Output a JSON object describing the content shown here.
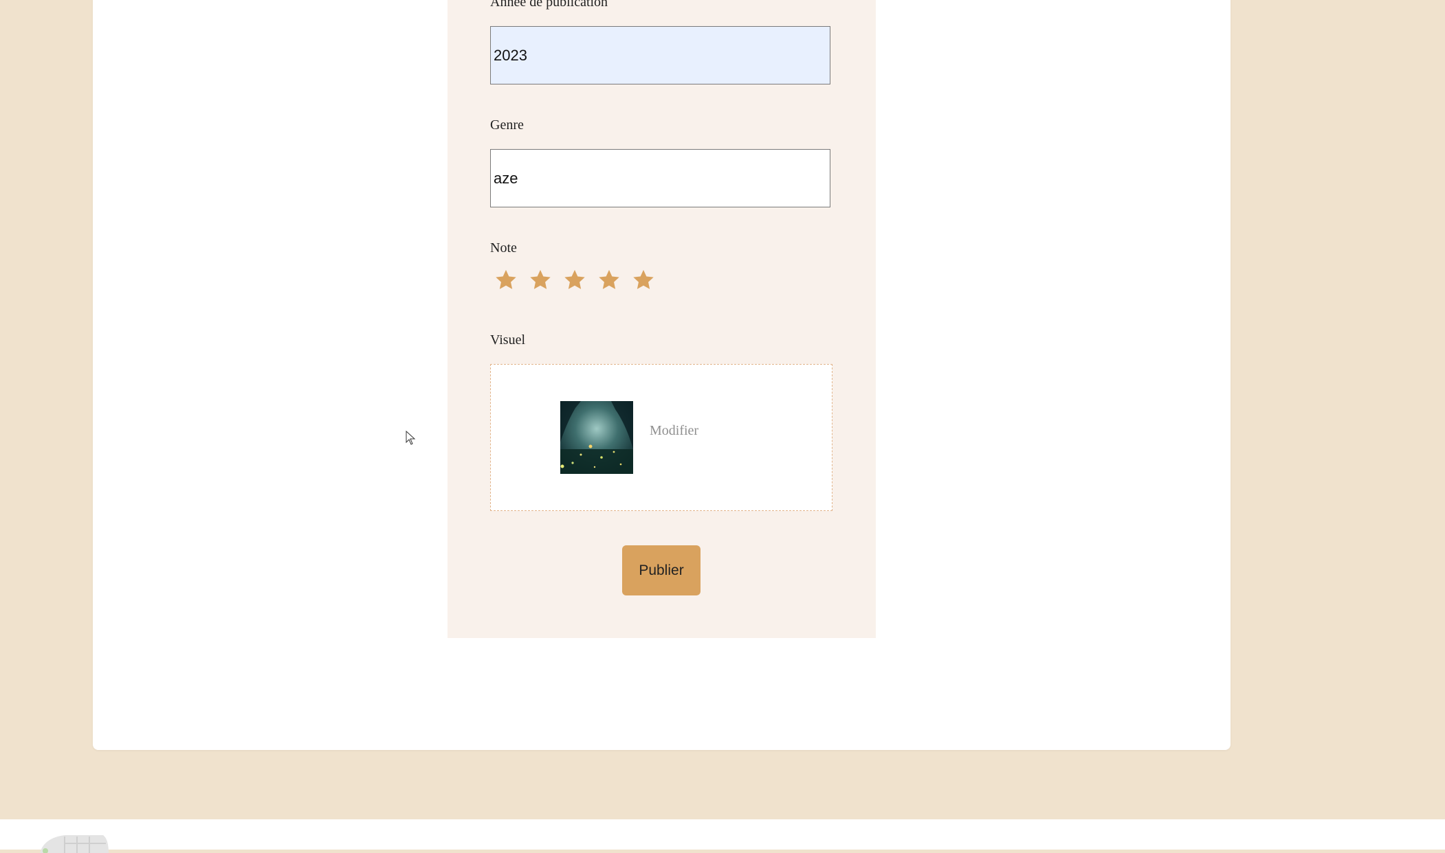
{
  "form": {
    "year_label": "Année de publication",
    "year_value": "2023",
    "genre_label": "Genre",
    "genre_value": "aze",
    "rating_label": "Note",
    "rating": {
      "value": 5,
      "max": 5
    },
    "visual_label": "Visuel",
    "modify_label": "Modifier",
    "publish_label": "Publier"
  },
  "colors": {
    "page_background": "#f0e2cd",
    "panel_background": "#f9f1eb",
    "accent": "#d9a25e",
    "star": "#d9a25e",
    "autofill_background": "#e8f0fe",
    "dropzone_border": "#e2b48a"
  },
  "icons": {
    "star": "star-icon",
    "cursor": "mouse-pointer-icon"
  }
}
